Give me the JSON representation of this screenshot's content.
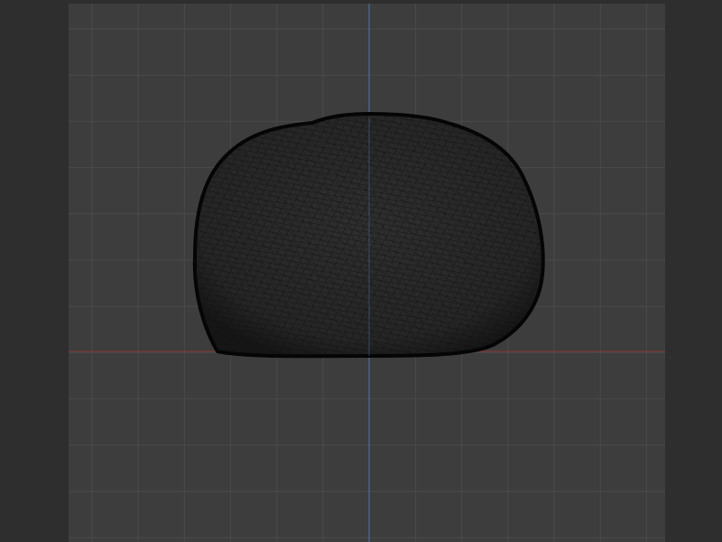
{
  "viewport": {
    "view": "front-orthographic",
    "shading": "wireframe",
    "grid": true,
    "axes": [
      "x",
      "z"
    ]
  },
  "colors": {
    "app_background": "#2e2e2e",
    "viewport_background": "#3d3d3d",
    "grid_line": "#4a4a4a",
    "grid_major_line": "#545454",
    "x_axis": "#8a3a3a",
    "z_axis": "#3f6fa8",
    "mesh_fill": "#2a2a2a",
    "mesh_wire": "#111111",
    "mesh_outline": "#050505"
  },
  "icons": {
    "mesh_object": "wireframe-mesh-icon"
  }
}
